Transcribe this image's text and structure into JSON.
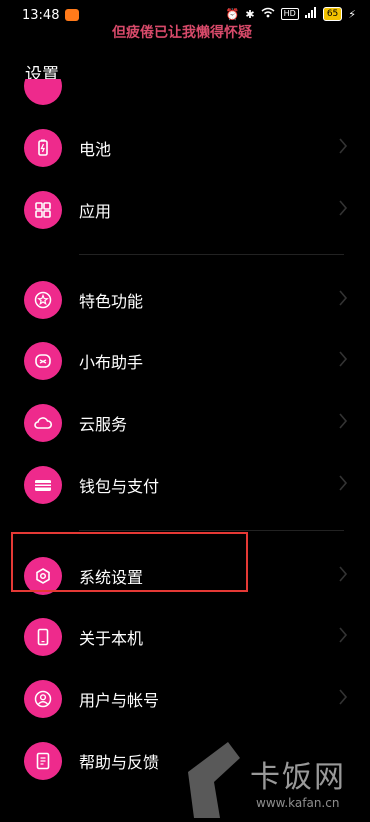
{
  "status": {
    "time": "13:48",
    "notice": "但疲倦已让我懒得怀疑",
    "hd": "HD",
    "battery": "65"
  },
  "header": {
    "title": "设置"
  },
  "menu": [
    {
      "label": "电池",
      "icon": "battery-icon"
    },
    {
      "label": "应用",
      "icon": "apps-icon"
    },
    {
      "label": "特色功能",
      "icon": "star-icon"
    },
    {
      "label": "小布助手",
      "icon": "assistant-icon"
    },
    {
      "label": "云服务",
      "icon": "cloud-icon"
    },
    {
      "label": "钱包与支付",
      "icon": "wallet-icon"
    },
    {
      "label": "系统设置",
      "icon": "settings-icon"
    },
    {
      "label": "关于本机",
      "icon": "phone-icon"
    },
    {
      "label": "用户与帐号",
      "icon": "user-icon"
    },
    {
      "label": "帮助与反馈",
      "icon": "help-icon"
    }
  ],
  "watermark": {
    "brand": "卡饭网",
    "url": "www.kafan.cn"
  },
  "colors": {
    "accent": "#ee2a8c",
    "highlight_box": "#e53935",
    "background": "#000000"
  }
}
